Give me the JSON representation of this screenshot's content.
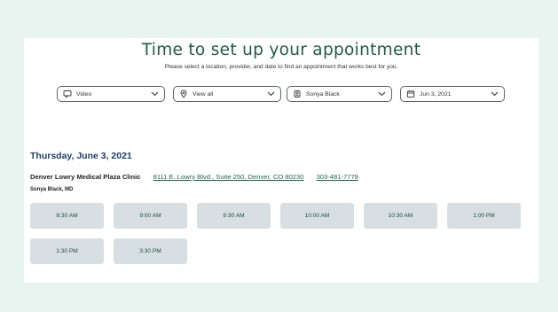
{
  "page": {
    "title": "Time to set up your appointment",
    "subtitle": "Please select a location, provider, and date to find an appointment that works best for you."
  },
  "filters": {
    "visit_type": "Video",
    "location": "View all",
    "provider": "Sonya Black",
    "date": "Jun 3, 2021"
  },
  "schedule": {
    "date_heading": "Thursday, June 3, 2021",
    "clinic_name": "Denver Lowry Medical Plaza Clinic",
    "address": "8111 E. Lowry Blvd., Suite 250, Denver, CO 80230",
    "phone": "303-481-7779",
    "provider_name": "Sonya Black, MD",
    "slots": [
      "8:30 AM",
      "9:00 AM",
      "9:30 AM",
      "10:00 AM",
      "10:30 AM",
      "1:00 PM",
      "1:30 PM",
      "3:30 PM"
    ]
  },
  "colors": {
    "page_background": "#e8f4ef",
    "accent_green": "#1f5c43",
    "heading_blue": "#1b3f6a",
    "slot_background": "#d7dfe2"
  },
  "icons": {
    "visit_type": "video-chat-icon",
    "location": "location-pin-icon",
    "provider": "provider-badge-icon",
    "date": "calendar-icon",
    "dropdown": "chevron-down-icon"
  }
}
